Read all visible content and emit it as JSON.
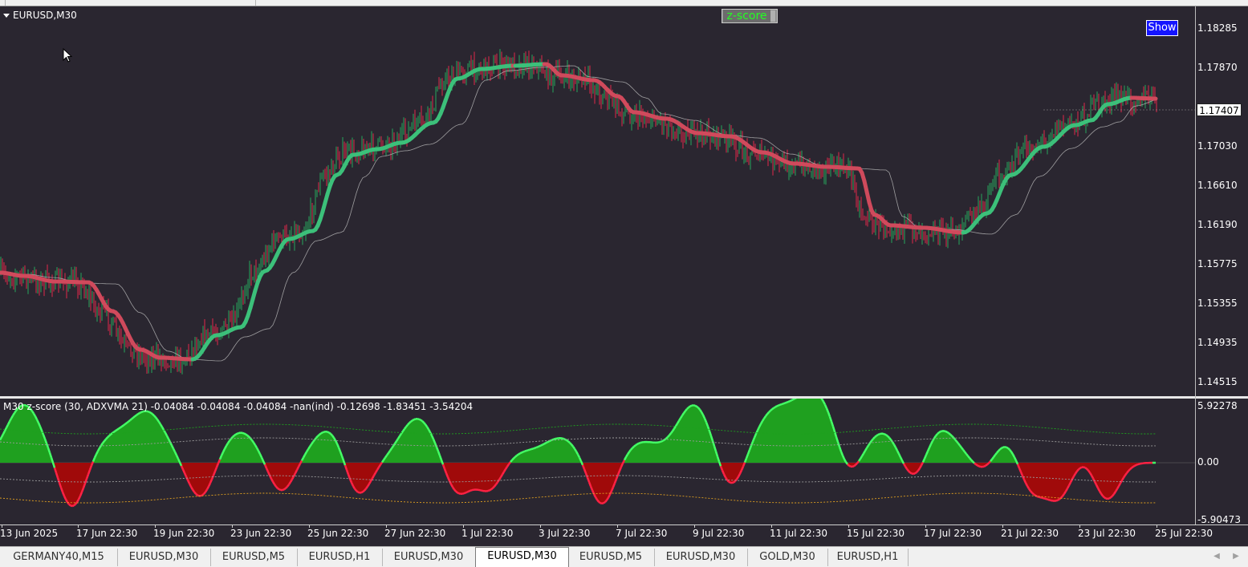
{
  "main_chart": {
    "symbol_label": "EURUSD,M30",
    "y_ticks": [
      "1.18285",
      "1.17870",
      "1.17455",
      "1.17030",
      "1.16610",
      "1.16190",
      "1.15775",
      "1.15355",
      "1.14935",
      "1.14515"
    ],
    "current_price": "1.17407",
    "zscore_button": "z-score",
    "show_button": "Show",
    "colors": {
      "background": "#2a2630",
      "up_candle": "#26a65b",
      "down_candle": "#e0284a",
      "ma_up": "#3cc07a",
      "ma_down": "#d04a5c"
    }
  },
  "sub_chart": {
    "label": "M30 z-score (30, ADXVMA 21) -0.04084 -0.04084 -0.04084 -nan(ind) -0.12698 -1.83451 -3.54204",
    "y_ticks": [
      "5.92278",
      "0.00",
      "-5.90473"
    ]
  },
  "x_axis": {
    "ticks": [
      "13 Jun 2025",
      "17 Jun 22:30",
      "19 Jun 22:30",
      "23 Jun 22:30",
      "25 Jun 22:30",
      "27 Jun 22:30",
      "1 Jul 22:30",
      "3 Jul 22:30",
      "7 Jul 22:30",
      "9 Jul 22:30",
      "11 Jul 22:30",
      "15 Jul 22:30",
      "17 Jul 22:30",
      "21 Jul 22:30",
      "23 Jul 22:30",
      "25 Jul 22:30"
    ]
  },
  "tabs": [
    {
      "label": "GERMANY40,M15",
      "active": false
    },
    {
      "label": "EURUSD,M30",
      "active": false
    },
    {
      "label": "EURUSD,M5",
      "active": false
    },
    {
      "label": "EURUSD,H1",
      "active": false
    },
    {
      "label": "EURUSD,M30",
      "active": false
    },
    {
      "label": "EURUSD,M30",
      "active": true
    },
    {
      "label": "EURUSD,M5",
      "active": false
    },
    {
      "label": "EURUSD,M30",
      "active": false
    },
    {
      "label": "GOLD,M30",
      "active": false
    },
    {
      "label": "EURUSD,H1",
      "active": false
    }
  ]
}
